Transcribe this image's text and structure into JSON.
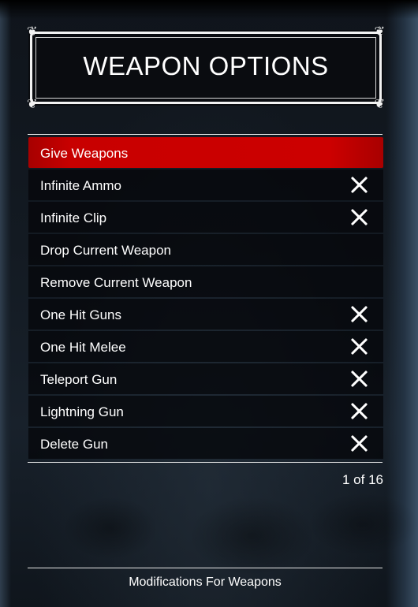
{
  "header": {
    "title": "WEAPON OPTIONS"
  },
  "menu": {
    "items": [
      {
        "label": "Give Weapons",
        "selected": true,
        "checked": false
      },
      {
        "label": "Infinite Ammo",
        "selected": false,
        "checked": true
      },
      {
        "label": "Infinite Clip",
        "selected": false,
        "checked": true
      },
      {
        "label": "Drop Current Weapon",
        "selected": false,
        "checked": false
      },
      {
        "label": "Remove Current Weapon",
        "selected": false,
        "checked": false
      },
      {
        "label": "One Hit Guns",
        "selected": false,
        "checked": true
      },
      {
        "label": "One Hit Melee",
        "selected": false,
        "checked": true
      },
      {
        "label": "Teleport Gun",
        "selected": false,
        "checked": true
      },
      {
        "label": "Lightning Gun",
        "selected": false,
        "checked": true
      },
      {
        "label": "Delete Gun",
        "selected": false,
        "checked": true
      }
    ],
    "checked_icon": "x-mark-icon",
    "page_indicator": "1 of 16"
  },
  "footer": {
    "description": "Modifications For Weapons"
  },
  "colors": {
    "selected": "#cc0000",
    "background": "#0d1117",
    "text": "#ffffff"
  }
}
